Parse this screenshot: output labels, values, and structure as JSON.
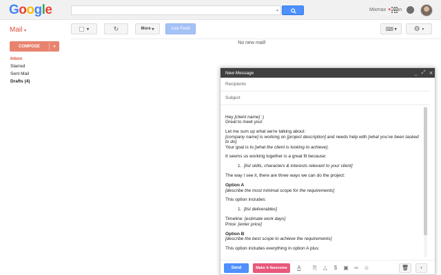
{
  "header": {
    "logo_letters": [
      "G",
      "o",
      "o",
      "g",
      "l",
      "e"
    ],
    "mixmax": "Mixmax",
    "user_name": "Ran"
  },
  "toolbar": {
    "mail_label": "Mail",
    "mail_caret": "▾",
    "select_caret": "▾",
    "refresh_glyph": "↻",
    "more_label": "More",
    "more_caret": "▾",
    "live_feed_label": "Live Feed",
    "keyboard_glyph": "⌨",
    "keyboard_caret": "▾",
    "settings_glyph": "⚙",
    "settings_caret": "▾"
  },
  "sidebar": {
    "compose_label": "COMPOSE",
    "compose_caret": "▾",
    "items": [
      {
        "label": "Inbox",
        "active": true
      },
      {
        "label": "Starred"
      },
      {
        "label": "Sent Mail"
      },
      {
        "label": "Drafts (4)",
        "bold": true
      }
    ]
  },
  "main": {
    "empty_message": "No new mail!"
  },
  "compose": {
    "title": "New Message",
    "controls": {
      "minimize": "_",
      "popout": "⤢",
      "close": "×"
    },
    "recipients_label": "Recipients",
    "subject_label": "Subject",
    "body": {
      "l1_a": "Hey ",
      "l1_b": "[client name]",
      "l1_c": " :)",
      "l2": "Great to meet you!",
      "l3": "Let me sum up what we're talking about:",
      "l4_a": "[company name]",
      "l4_b": " is working on ",
      "l4_c": "[project description]",
      "l4_d": " and needs help with ",
      "l4_e": "[what you've been tasked",
      "l5": "to do]",
      "l6_a": "Your goal is to ",
      "l6_b": "[what the client is looking to achieve]",
      "l6_c": ".",
      "l7": "It seems us working together is a great fit because:",
      "l8_num": "1.",
      "l8": "[list skills, characters & interests relevant to your client]",
      "l9": "The way I see it, there are three ways we can do the project:",
      "l10": "Option A",
      "l11": "[describe the most minimal scope for the requirements]",
      "l12": "This option includes:",
      "l13_num": "1.",
      "l13": "[list deliverables]",
      "l14_a": "Timeline: ",
      "l14_b": "[estimate work days]",
      "l15_a": "Price: ",
      "l15_b": "[enter price]",
      "l16": "Option B",
      "l17": "[describe the best scope to achieve the requirements]",
      "l18": "This option includes everything in option A plus:"
    },
    "send_label": "Send",
    "awesome_label": "Make it Awesome",
    "tool_glyphs": {
      "format": "A",
      "attach": "⎘",
      "drive": "△",
      "money": "$",
      "photo": "▣",
      "link": "∞",
      "emoji": "☺"
    },
    "trash_glyph": "🗑",
    "more_caret": "▾"
  }
}
